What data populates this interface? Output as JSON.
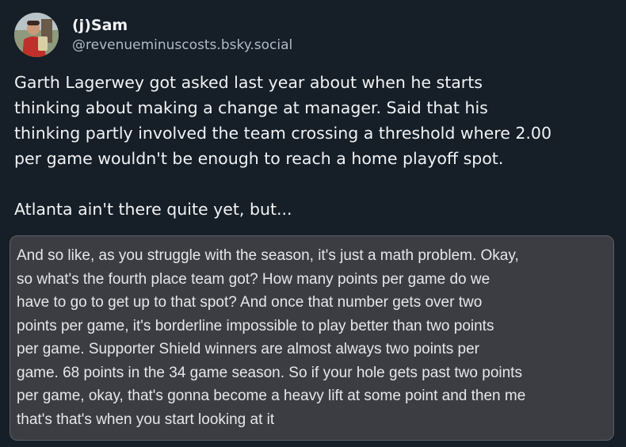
{
  "author": {
    "display_name": "(j)Sam",
    "handle": "@revenueminuscosts.bsky.social",
    "avatar_icon": "profile-photo-avatar"
  },
  "post": {
    "line1": "Garth Lagerwey got asked last year about when he starts",
    "line2": "thinking about making a change at manager. Said that his",
    "line3": "thinking partly involved the team crossing a threshold where 2.00",
    "line4": "per game wouldn't be enough to reach a home playoff spot.",
    "line5": "Atlanta ain't there quite yet, but..."
  },
  "quote_image": {
    "lines": [
      "And so like, as you struggle with the season, it's just a math problem. Okay,",
      "so what's the fourth place team got? How many points per game do we",
      "have to go to get up to that spot? And once that number gets over two",
      "points per game, it's borderline impossible to play better than two points",
      "per game. Supporter Shield winners are almost always two points per",
      "game. 68 points in the 34 game season. So if your hole gets past two points",
      "per game, okay, that's gonna become a heavy lift at some point and then me",
      "that's that's when you start looking at it"
    ]
  },
  "colors": {
    "background": "#161e27",
    "text": "#f1f3f5",
    "handle": "#aebbc9",
    "quote_background": "#3b3d42",
    "quote_border": "#5a6069"
  }
}
